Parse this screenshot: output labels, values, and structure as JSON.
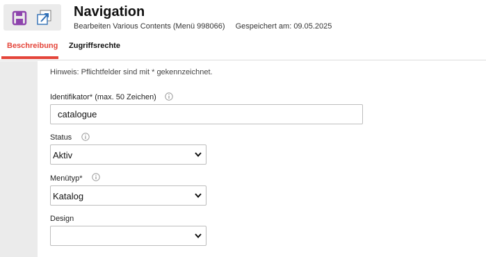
{
  "header": {
    "title": "Navigation",
    "subtitle": "Bearbeiten Various Contents (Menü 998066)",
    "saved": "Gespeichert am: 09.05.2025"
  },
  "toolbar": {
    "save_icon": "save-icon",
    "export_icon": "export-icon"
  },
  "tabs": [
    {
      "label": "Beschreibung",
      "active": true
    },
    {
      "label": "Zugriffsrechte",
      "active": false
    }
  ],
  "form": {
    "hint": "Hinweis: Pflichtfelder sind mit * gekennzeichnet.",
    "identifier": {
      "label": "Identifikator* (max. 50 Zeichen)",
      "value": "catalogue"
    },
    "status": {
      "label": "Status",
      "value": "Aktiv"
    },
    "menutype": {
      "label": "Menütyp*",
      "value": "Katalog"
    },
    "design": {
      "label": "Design",
      "value": ""
    }
  },
  "colors": {
    "accent": "#e4453a",
    "toolbar_bg": "#ebebeb",
    "save_icon": "#8e44ad",
    "export_icon": "#2f6eb5"
  }
}
